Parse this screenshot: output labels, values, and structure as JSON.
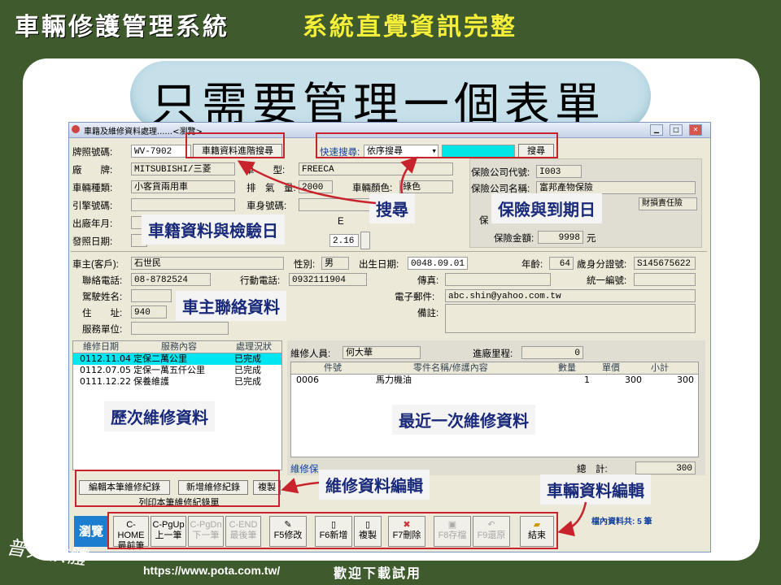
{
  "slide": {
    "title_main": "車輛修護管理系統",
    "title_accent": "系統直覺資訊完整",
    "headline": "只需要管理一個表單",
    "url": "https://www.pota.com.tw/",
    "download_text": "歡迎下載試用",
    "logo_text": "普大軟體"
  },
  "window": {
    "title": "車籍及維修資料處理......<瀏覽>"
  },
  "vehicle": {
    "plate_label": "牌照號碼:",
    "plate_value": "WV-7902",
    "brand_label": "廠　　牌:",
    "brand_value": "MITSUBISHI/三菱",
    "model_label": "車　　型:",
    "model_value": "FREECA",
    "type_label": "車輛種類:",
    "type_value": "小客貨兩用車",
    "cc_label": "排　氣　量:",
    "cc_value": "2000",
    "color_label": "車輛顏色:",
    "color_value": "綠色",
    "engine_label": "引擎號碼:",
    "body_label": "車身號碼:",
    "year_label": "出廠年月:",
    "issue_label": "發照日期:",
    "date_fragment": "2.16",
    "e_fragment": "E",
    "adv_search_btn": "車籍資料進階搜尋",
    "quick_search_label": "快速搜尋:",
    "quick_search_select": "依序搜尋",
    "search_btn": "搜尋"
  },
  "insurance": {
    "code_label": "保險公司代號:",
    "code_value": "I003",
    "name_label": "保險公司名稱:",
    "name_value": "富邦產物保險",
    "type_fragment": "財損責任險",
    "amount_label": "保險金額:",
    "amount_value": "9998",
    "amount_unit": "元",
    "side_fragment": "保"
  },
  "owner": {
    "owner_label": "車主(客戶):",
    "owner_value": "石世民",
    "gender_label": "性別:",
    "gender_value": "男",
    "birth_label": "出生日期:",
    "birth_value": "0048.09.01",
    "age_label": "年齡:",
    "age_value": "64",
    "age_unit": "歲",
    "id_label": "身分證號:",
    "id_value": "S145675622",
    "phone_label": "聯絡電話:",
    "phone_value": "08-8782524",
    "mobile_label": "行動電話:",
    "mobile_value": "0932111904",
    "fax_label": "傳真:",
    "tax_label": "統一編號:",
    "driver_label": "駕駛姓名:",
    "email_label": "電子郵件:",
    "email_value": "abc.shin@yahoo.com.tw",
    "addr_label": "住　　址:",
    "addr_value": "940",
    "note_label": "備註:",
    "unit_label": "服務單位:"
  },
  "history": {
    "headers": [
      "維修日期",
      "服務內容",
      "處理況狀"
    ],
    "rows": [
      {
        "date": "0112.11.04",
        "content": "定保二萬公里",
        "status": "已完成"
      },
      {
        "date": "0112.07.05",
        "content": "定保一萬五仟公里",
        "status": "已完成"
      },
      {
        "date": "0111.12.22",
        "content": "保養維護",
        "status": "已完成"
      }
    ],
    "edit_btn": "編輯本筆維修紀錄",
    "add_btn": "新增維修紀錄",
    "copy_btn": "複製",
    "print_btn": "列印本筆維修紀錄單"
  },
  "latest": {
    "tech_label": "維修人員:",
    "tech_value": "何大華",
    "mileage_label": "進廠里程:",
    "mileage_value": "0",
    "headers": [
      "件號",
      "零件名稱/修護內容",
      "數量",
      "單價",
      "小計"
    ],
    "rows": [
      {
        "part": "0006",
        "name": "馬力機油",
        "qty": "1",
        "price": "300",
        "subtotal": "300"
      }
    ],
    "summary_label": "維修保",
    "total_label": "總　計:",
    "total_value": "300",
    "count_text": "檔內資料共: 5 筆"
  },
  "toolbar": {
    "browse": "瀏覽",
    "buttons": [
      {
        "top": "C-HOME",
        "bottom": "最前筆",
        "enabled": true
      },
      {
        "top": "C-PgUp",
        "bottom": "上一筆",
        "enabled": true
      },
      {
        "top": "C-PgDn",
        "bottom": "下一筆",
        "enabled": false
      },
      {
        "top": "C-END",
        "bottom": "最後筆",
        "enabled": false
      }
    ],
    "actions": [
      {
        "label": "F5修改",
        "enabled": true
      },
      {
        "label": "F6新增",
        "enabled": true
      },
      {
        "label": "複製",
        "enabled": true
      },
      {
        "label": "F7刪除",
        "enabled": true
      },
      {
        "label": "F8存檔",
        "enabled": false
      },
      {
        "label": "F9還原",
        "enabled": false
      },
      {
        "label": "結束",
        "enabled": true
      }
    ]
  },
  "callouts": {
    "search": "搜尋",
    "insurance": "保險與到期日",
    "vehicle": "車籍資料與檢驗日",
    "owner": "車主聯絡資料",
    "history": "歷次維修資料",
    "latest": "最近一次維修資料",
    "edit": "維修資料編輯",
    "vehicle_edit": "車輛資料編輯"
  },
  "colors": {
    "background": "#3f5a2c",
    "accent": "#f5ef3a",
    "highlight": "#c8232c",
    "callout_text": "#1a2a7a"
  }
}
